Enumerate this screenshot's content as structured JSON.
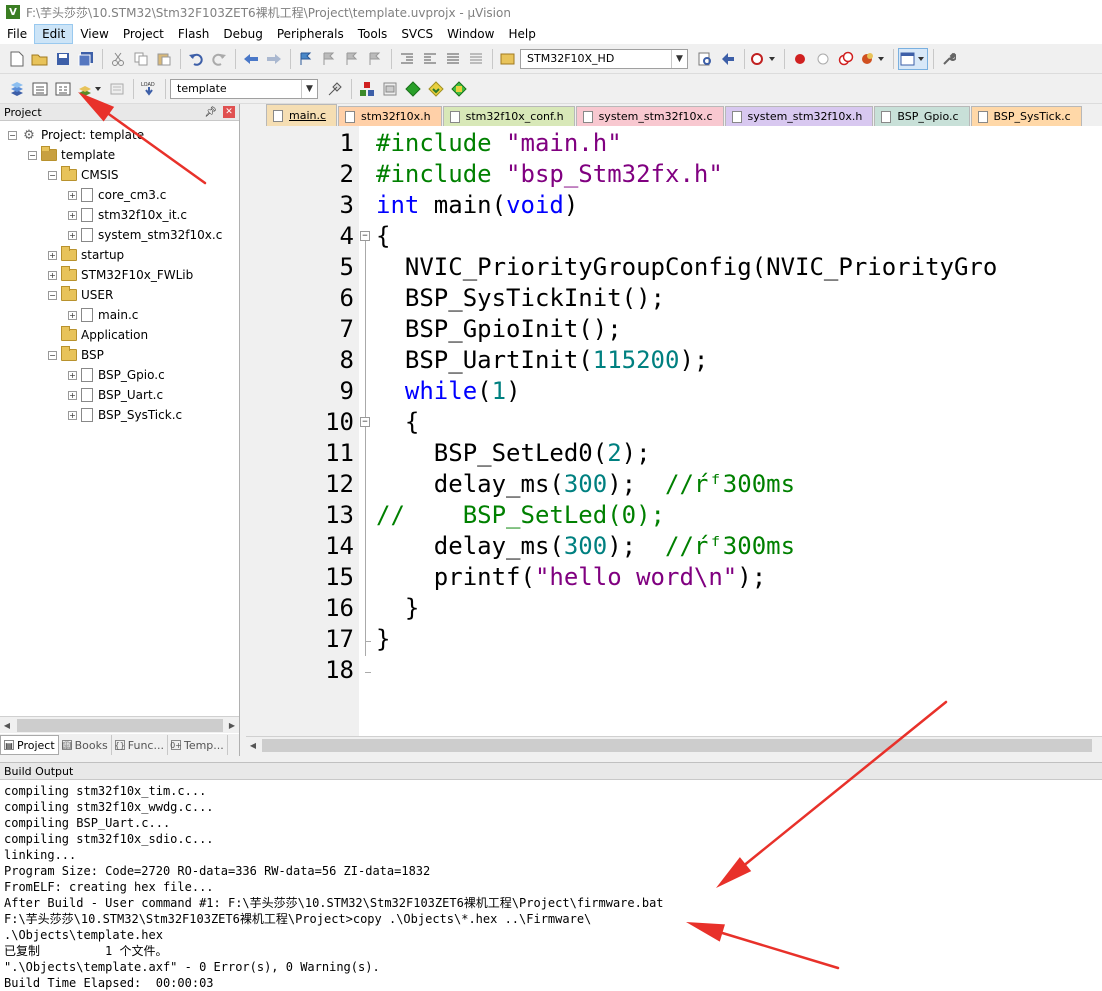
{
  "window": {
    "title": "F:\\芋头莎莎\\10.STM32\\Stm32F103ZET6裸机工程\\Project\\template.uvprojx - µVision",
    "app_icon": "V"
  },
  "menu": [
    "File",
    "Edit",
    "View",
    "Project",
    "Flash",
    "Debug",
    "Peripherals",
    "Tools",
    "SVCS",
    "Window",
    "Help"
  ],
  "toolbar1": {
    "device_combo": "STM32F10X_HD"
  },
  "toolbar2": {
    "target_combo": "template"
  },
  "project_panel": {
    "title": "Project",
    "tree": [
      {
        "label": "Project: template",
        "level": 0,
        "kind": "project",
        "expander": "-"
      },
      {
        "label": "template",
        "level": 1,
        "kind": "target",
        "expander": "-"
      },
      {
        "label": "CMSIS",
        "level": 2,
        "kind": "folder",
        "expander": "-"
      },
      {
        "label": "core_cm3.c",
        "level": 3,
        "kind": "file",
        "expander": "+"
      },
      {
        "label": "stm32f10x_it.c",
        "level": 3,
        "kind": "file",
        "expander": "+"
      },
      {
        "label": "system_stm32f10x.c",
        "level": 3,
        "kind": "file",
        "expander": "+"
      },
      {
        "label": "startup",
        "level": 2,
        "kind": "folder",
        "expander": "+"
      },
      {
        "label": "STM32F10x_FWLib",
        "level": 2,
        "kind": "folder",
        "expander": "+"
      },
      {
        "label": "USER",
        "level": 2,
        "kind": "folder",
        "expander": "-"
      },
      {
        "label": "main.c",
        "level": 3,
        "kind": "file",
        "expander": "+"
      },
      {
        "label": "Application",
        "level": 2,
        "kind": "folder",
        "expander": ""
      },
      {
        "label": "BSP",
        "level": 2,
        "kind": "folder",
        "expander": "-"
      },
      {
        "label": "BSP_Gpio.c",
        "level": 3,
        "kind": "file",
        "expander": "+"
      },
      {
        "label": "BSP_Uart.c",
        "level": 3,
        "kind": "file",
        "expander": "+"
      },
      {
        "label": "BSP_SysTick.c",
        "level": 3,
        "kind": "file",
        "expander": "+"
      }
    ],
    "tabs": [
      "Project",
      "Books",
      "Func...",
      "Temp..."
    ]
  },
  "editor_tabs": [
    {
      "label": "main.c",
      "color": "#f5deb3",
      "active": true
    },
    {
      "label": "stm32f10x.h",
      "color": "#ffd0a8",
      "active": false
    },
    {
      "label": "stm32f10x_conf.h",
      "color": "#d8e8b8",
      "active": false
    },
    {
      "label": "system_stm32f10x.c",
      "color": "#f8c8d0",
      "active": false
    },
    {
      "label": "system_stm32f10x.h",
      "color": "#d8c8f0",
      "active": false
    },
    {
      "label": "BSP_Gpio.c",
      "color": "#c8e0d8",
      "active": false
    },
    {
      "label": "BSP_SysTick.c",
      "color": "#ffd8a8",
      "active": false
    }
  ],
  "code": [
    {
      "n": "1",
      "fold": "",
      "tokens": [
        [
          "pre",
          "#include "
        ],
        [
          "str",
          "\"main.h\""
        ]
      ]
    },
    {
      "n": "2",
      "fold": "",
      "tokens": [
        [
          "pre",
          "#include "
        ],
        [
          "str",
          "\"bsp_Stm32fx.h\""
        ]
      ]
    },
    {
      "n": "3",
      "fold": "",
      "tokens": [
        [
          "kw",
          "int"
        ],
        [
          "plain",
          " main("
        ],
        [
          "kw",
          "void"
        ],
        [
          "plain",
          ")"
        ]
      ]
    },
    {
      "n": "4",
      "fold": "-",
      "tokens": [
        [
          "plain",
          "{"
        ]
      ]
    },
    {
      "n": "5",
      "fold": "",
      "tokens": [
        [
          "plain",
          "  NVIC_PriorityGroupConfig(NVIC_PriorityGro"
        ]
      ]
    },
    {
      "n": "6",
      "fold": "",
      "tokens": [
        [
          "plain",
          "  BSP_SysTickInit();"
        ]
      ]
    },
    {
      "n": "7",
      "fold": "",
      "tokens": [
        [
          "plain",
          "  BSP_GpioInit();"
        ]
      ]
    },
    {
      "n": "8",
      "fold": "",
      "tokens": [
        [
          "plain",
          "  BSP_UartInit("
        ],
        [
          "num",
          "115200"
        ],
        [
          "plain",
          ");"
        ]
      ]
    },
    {
      "n": "9",
      "fold": "",
      "tokens": [
        [
          "plain",
          "  "
        ],
        [
          "kw",
          "while"
        ],
        [
          "plain",
          "("
        ],
        [
          "num",
          "1"
        ],
        [
          "plain",
          ")"
        ]
      ]
    },
    {
      "n": "10",
      "fold": "-",
      "tokens": [
        [
          "plain",
          "  {"
        ]
      ]
    },
    {
      "n": "11",
      "fold": "",
      "tokens": [
        [
          "plain",
          "    BSP_SetLed0("
        ],
        [
          "num",
          "2"
        ],
        [
          "plain",
          ");"
        ]
      ]
    },
    {
      "n": "12",
      "fold": "",
      "tokens": [
        [
          "plain",
          "    delay_ms("
        ],
        [
          "num",
          "300"
        ],
        [
          "plain",
          ");  "
        ],
        [
          "cmt",
          "//ŕᶠ300ms"
        ]
      ]
    },
    {
      "n": "13",
      "fold": "",
      "tokens": [
        [
          "cmt",
          "//    BSP_SetLed(0);"
        ]
      ]
    },
    {
      "n": "14",
      "fold": "",
      "tokens": [
        [
          "plain",
          "    delay_ms("
        ],
        [
          "num",
          "300"
        ],
        [
          "plain",
          ");  "
        ],
        [
          "cmt",
          "//ŕᶠ300ms"
        ]
      ]
    },
    {
      "n": "15",
      "fold": "",
      "tokens": [
        [
          "plain",
          "    printf("
        ],
        [
          "str",
          "\"hello word\\n\""
        ],
        [
          "plain",
          ");"
        ]
      ]
    },
    {
      "n": "16",
      "fold": "",
      "tokens": [
        [
          "plain",
          "  }"
        ]
      ]
    },
    {
      "n": "17",
      "fold": "",
      "tokens": [
        [
          "plain",
          "}"
        ]
      ]
    },
    {
      "n": "18",
      "fold": "",
      "tokens": []
    }
  ],
  "build_output": {
    "title": "Build Output",
    "lines": [
      "compiling stm32f10x_tim.c...",
      "compiling stm32f10x_wwdg.c...",
      "compiling BSP_Uart.c...",
      "compiling stm32f10x_sdio.c...",
      "linking...",
      "Program Size: Code=2720 RO-data=336 RW-data=56 ZI-data=1832",
      "FromELF: creating hex file...",
      "After Build - User command #1: F:\\芋头莎莎\\10.STM32\\Stm32F103ZET6裸机工程\\Project\\firmware.bat",
      "F:\\芋头莎莎\\10.STM32\\Stm32F103ZET6裸机工程\\Project>copy .\\Objects\\*.hex ..\\Firmware\\",
      ".\\Objects\\template.hex",
      "已复制         1 个文件。",
      "\".\\Objects\\template.axf\" - 0 Error(s), 0 Warning(s).",
      "Build Time Elapsed:  00:00:03"
    ]
  },
  "colors": {
    "annotation_arrow": "#e8312a"
  }
}
